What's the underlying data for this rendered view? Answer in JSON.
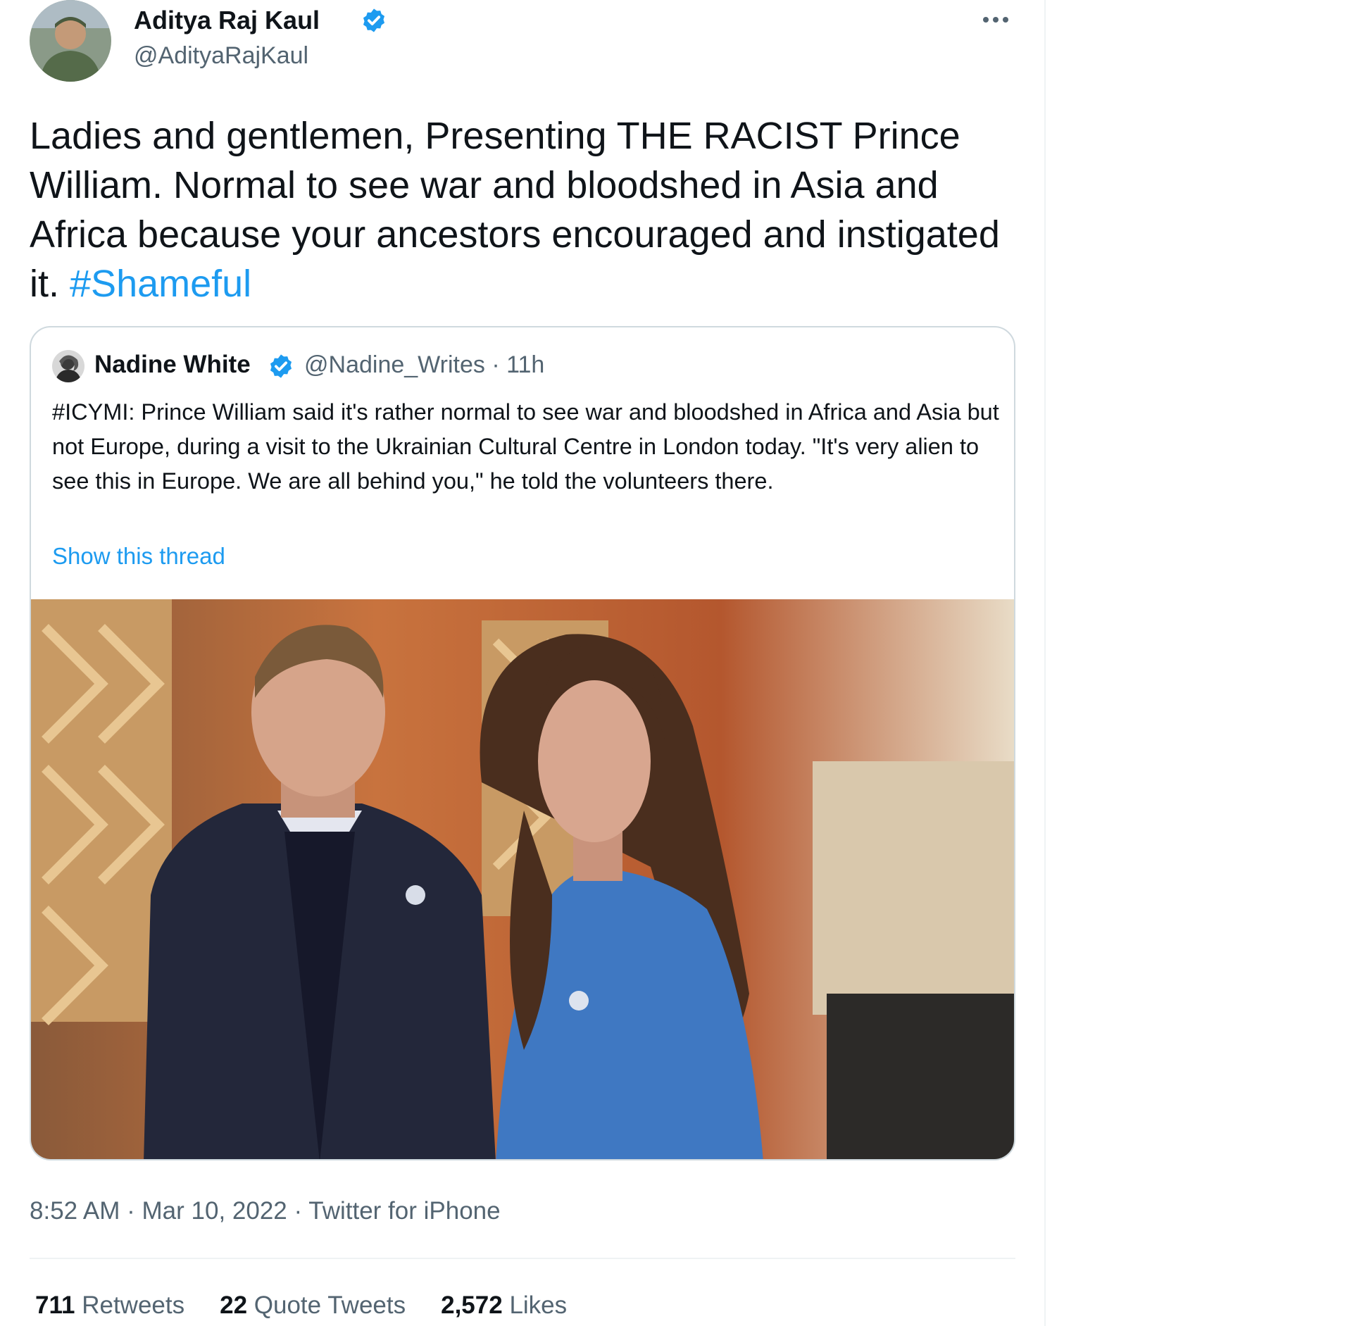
{
  "author": {
    "name": "Aditya Raj Kaul",
    "handle": "@AdityaRajKaul",
    "verified_icon": "verified-badge-icon"
  },
  "tweet": {
    "text": "Ladies and gentlemen, Presenting THE RACIST Prince William. Normal to see war and bloodshed in Asia and Africa because your ancestors encouraged and instigated it. ",
    "hashtag": "#Shameful"
  },
  "quote": {
    "name": "Nadine White",
    "meta": "@Nadine_Writes · 11h",
    "text": "#ICYMI: Prince William said it's rather normal to see war and bloodshed in Africa and Asia but not Europe, during a visit to the Ukrainian Cultural Centre in London today. \"It's very alien to see this in Europe. We are all behind you,\" he told the volunteers there.",
    "show_thread": "Show this thread"
  },
  "footer": {
    "time": "8:52 AM",
    "separator": " · ",
    "date": "Mar 10, 2022",
    "source": "Twitter for iPhone"
  },
  "stats": {
    "retweets_count": "711",
    "retweets_label": "Retweets",
    "quotes_count": "22",
    "quotes_label": "Quote Tweets",
    "likes_count": "2,572",
    "likes_label": "Likes"
  },
  "colors": {
    "accent": "#1d9bf0",
    "secondary_text": "#536471",
    "border": "#cfd9de"
  }
}
